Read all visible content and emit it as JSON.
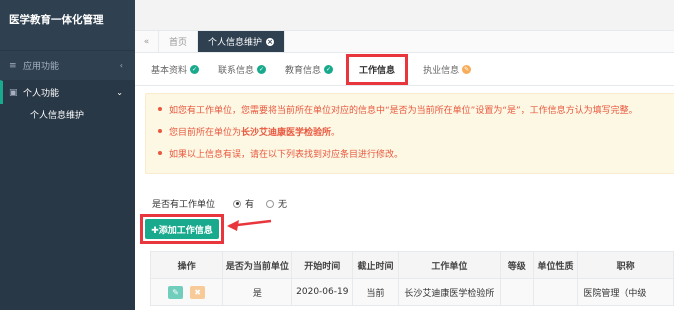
{
  "app": {
    "title": "医学教育一体化管理"
  },
  "sidebar": {
    "groups": [
      {
        "label": "应用功能",
        "icon": "hamburger-icon",
        "arrow": "‹"
      },
      {
        "label": "个人功能",
        "icon": "document-icon",
        "arrow": "⌄"
      }
    ],
    "sub_items": [
      {
        "label": "个人信息维护"
      }
    ]
  },
  "tabs": {
    "nav": "«",
    "items": [
      {
        "label": "首页"
      },
      {
        "label": "个人信息维护"
      }
    ],
    "close": "×"
  },
  "steps": [
    {
      "label": "基本资料",
      "status": "done"
    },
    {
      "label": "联系信息",
      "status": "done"
    },
    {
      "label": "教育信息",
      "status": "done"
    },
    {
      "label": "工作信息",
      "status": "current"
    },
    {
      "label": "执业信息",
      "status": "edit"
    }
  ],
  "notice": {
    "line1": "如您有工作单位，您需要将当前所在单位对应的信息中“是否为当前所在单位”设置为“是”，工作信息方认为填写完整。",
    "line2_prefix": "您目前所在单位为",
    "line2_bold": "长沙艾迪康医学检验所",
    "line2_suffix": "。",
    "line3": "如果以上信息有误，请在以下列表找到对应条目进行修改。"
  },
  "work_unit": {
    "question": "是否有工作单位",
    "yes": "有",
    "no": "无",
    "selected": "有"
  },
  "add_button": {
    "label": "✚添加工作信息"
  },
  "table": {
    "headers": [
      "操作",
      "是否为当前单位",
      "开始时间",
      "截止时间",
      "工作单位",
      "等级",
      "单位性质",
      "职称"
    ],
    "rows": [
      [
        "",
        "是",
        "2020-06-19",
        "当前",
        "长沙艾迪康医学检验所",
        "",
        "",
        "医院管理（中级"
      ]
    ]
  },
  "colors": {
    "sidebar": "#2f4050",
    "accent": "#19aa8d",
    "warning": "#f8ac59",
    "highlight": "#e8363c",
    "notice_text": "#e9573f"
  }
}
